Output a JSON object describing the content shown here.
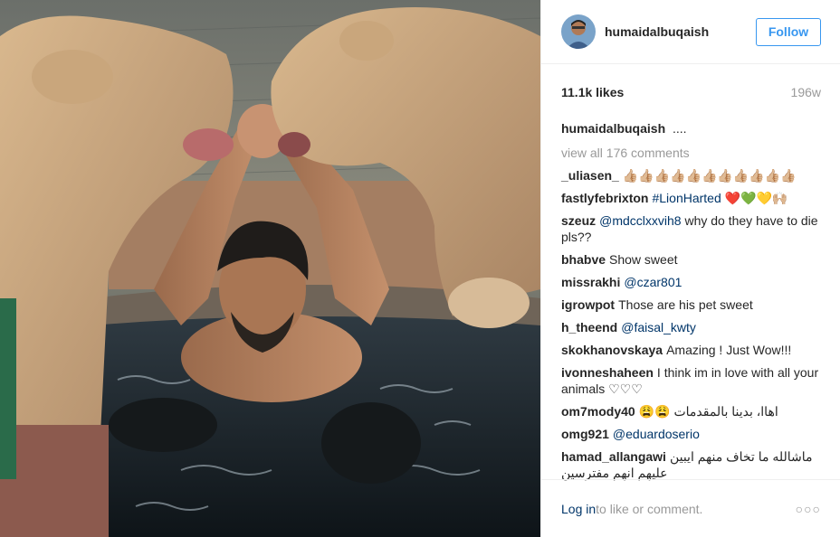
{
  "post": {
    "username": "humaidalbuqaish",
    "follow_label": "Follow",
    "likes": "11.1k likes",
    "time_ago": "196w",
    "caption_user": "humaidalbuqaish",
    "caption_text": "....",
    "view_all": "view all 176 comments"
  },
  "comments": [
    {
      "user": "_uliasen_",
      "text": "👍🏼👍🏼👍🏼👍🏼👍🏼👍🏼👍🏼👍🏼👍🏼👍🏼👍🏼",
      "mention": ""
    },
    {
      "user": "fastlyfebrixton",
      "mention": "#LionHarted",
      "text": " ❤️💚💛🙌🏼"
    },
    {
      "user": "szeuz",
      "mention": "@mdcclxxvih8",
      "text": " why do they have to die pls??"
    },
    {
      "user": "bhabve",
      "mention": "",
      "text": "Show sweet"
    },
    {
      "user": "missrakhi",
      "mention": "@czar801",
      "text": ""
    },
    {
      "user": "igrowpot",
      "mention": "",
      "text": "Those are his pet sweet"
    },
    {
      "user": "h_theend",
      "mention": "@faisal_kwty",
      "text": ""
    },
    {
      "user": "skokhanovskaya",
      "mention": "",
      "text": "Amazing ! Just Wow!!!"
    },
    {
      "user": "ivonneshaheen",
      "mention": "",
      "text": "I think im in love with all your animals ♡♡♡"
    },
    {
      "user": "om7mody40",
      "mention": "",
      "text": "اهاا، بدينا بالمقدمات 😩😩"
    },
    {
      "user": "omg921",
      "mention": "@eduardoserio",
      "text": ""
    },
    {
      "user": "hamad_allangawi",
      "mention": "",
      "text": "ماشالله ما تخاف منهم ايبين عليهم انهم مفترسين"
    }
  ],
  "footer": {
    "login_label": "Log in",
    "login_suffix": " to like or comment.",
    "more_label": "○○○"
  }
}
